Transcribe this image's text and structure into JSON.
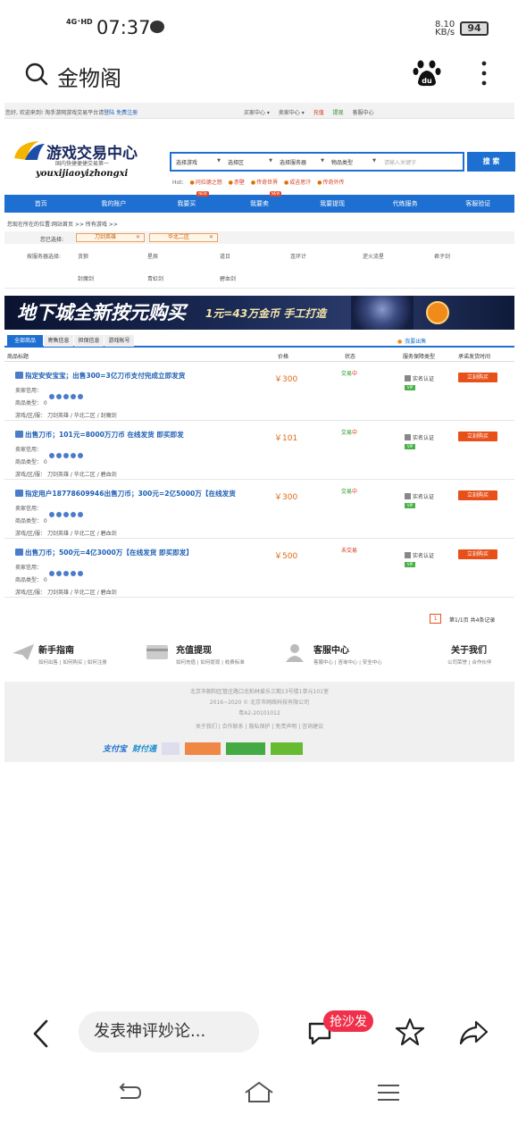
{
  "status_bar": {
    "network": "4G⁺HD",
    "time": "07:37",
    "speed_value": "8.10",
    "speed_unit": "KB/s",
    "battery": "94"
  },
  "browser": {
    "title": "金物阁"
  },
  "site": {
    "welcome": "您好, 欢迎来到!  淘手游网游戏交易平台请",
    "login": "登陆",
    "register": "免费注册",
    "top_links": [
      "买家中心 ▾",
      "卖家中心 ▾",
      "充值",
      "提现",
      "客服中心"
    ],
    "logo_name": "游戏交易中心",
    "logo_slogan": "国内快捷便捷交易第一",
    "logo_pinyin": "youxijiaoyizhongxi",
    "search": {
      "selects": [
        "选择游戏",
        "选择区",
        "选择服务器",
        "物品类型"
      ],
      "placeholder": "请输入关键字",
      "button": "搜 索"
    },
    "hot_label": "Hot:",
    "hot_items": [
      "问拉德之怒",
      "赤壁",
      "传奇世界",
      "成吉思汗",
      "传奇外传"
    ],
    "nav": [
      {
        "label": "首页",
        "new": ""
      },
      {
        "label": "我的账户",
        "new": ""
      },
      {
        "label": "我要买",
        "new": "NEW"
      },
      {
        "label": "我要卖",
        "new": "NEW"
      },
      {
        "label": "我要提现",
        "new": ""
      },
      {
        "label": "代练服务",
        "new": ""
      },
      {
        "label": "客服验证",
        "new": ""
      }
    ],
    "breadcrumb": "您现在所在的位置:网站首页 >> 所有游戏 >>",
    "chosen_label": "您已选择:",
    "chosen_tags": [
      "刀剑英雄",
      "华北二区"
    ],
    "server_label": "按服务器选择:",
    "servers_row1": [
      "贪狼",
      "星辰",
      "道日",
      "连环计",
      "逆火流星",
      "君子剑"
    ],
    "servers_row2": [
      "封魔剑",
      "青虹剑",
      "碧血剑"
    ],
    "banner": {
      "main": "地下城全新按元购买",
      "sub": "1元=43万金币  手工打造"
    },
    "tabs": [
      "全部商品",
      "寄售信息",
      "担保信息",
      "游戏帐号"
    ],
    "sell_link": "我要出售",
    "columns": [
      "商品标题",
      "价格",
      "状态",
      "服务保障类型",
      "承诺发货时间"
    ],
    "listings": [
      {
        "title": "指定安安宝宝；出售300=3亿刀币支付完成立即发货",
        "credit": "卖家信用：",
        "type": "商品类型：  0",
        "path": "游戏/区/服：  刀剑英雄 / 华北二区 / 封魔剑",
        "price": "￥300",
        "status_a": "交易",
        "status_b": "中",
        "service": "实名认证",
        "vip": "VIP",
        "buy": "立刻购买"
      },
      {
        "title": "出售刀币；101元=8000万刀币  在线发货  即买即发",
        "credit": "卖家信用：",
        "type": "商品类型：  0",
        "path": "游戏/区/服：  刀剑英雄 / 华北二区 / 碧血剑",
        "price": "￥101",
        "status_a": "交易",
        "status_b": "中",
        "service": "实名认证",
        "vip": "VIP",
        "buy": "立刻购买"
      },
      {
        "title": "指定用户18778609946出售刀币；300元=2亿5000万【在线发货",
        "credit": "卖家信用：",
        "type": "商品类型：  0",
        "path": "游戏/区/服：  刀剑英雄 / 华北二区 / 碧血剑",
        "price": "￥300",
        "status_a": "交易",
        "status_b": "中",
        "service": "实名认证",
        "vip": "VIP",
        "buy": "立刻购买"
      },
      {
        "title": "出售刀币；500元=4亿3000万【在线发货  即买即发】",
        "credit": "卖家信用：",
        "type": "商品类型：  0",
        "path": "游戏/区/服：  刀剑英雄 / 华北二区 / 碧血剑",
        "price": "￥500",
        "status_a": "未交易",
        "status_b": "",
        "service": "实名认证",
        "vip": "VIP",
        "buy": "立刻购买"
      }
    ],
    "pager": {
      "page": "1",
      "info": "第1/1页  共4条记录"
    },
    "guides": [
      {
        "title": "新手指南",
        "links": "如何出售 | 如何购买 | 如何注册"
      },
      {
        "title": "充值提现",
        "links": "如何充值 | 如何提现 | 收费标准"
      },
      {
        "title": "客服中心",
        "links": "客服中心 | 咨询中心 | 安全中心"
      },
      {
        "title": "关于我们",
        "links": "公司荣誉 | 合作伙伴"
      }
    ],
    "footer_lines": [
      "北京市朝阳区管庄路口北柏林爱乐三期13号楼1单元101室",
      "2016~2020 © 北京市网络科技有限公司",
      "粤A2-20101012",
      "关于我们 | 合作联系 | 隐私保护 | 免责声明 | 咨询建议"
    ],
    "footer_badges": [
      "支付宝",
      "财付通"
    ]
  },
  "comment_bar": {
    "placeholder": "发表神评妙论...",
    "sofa": "抢沙发"
  }
}
